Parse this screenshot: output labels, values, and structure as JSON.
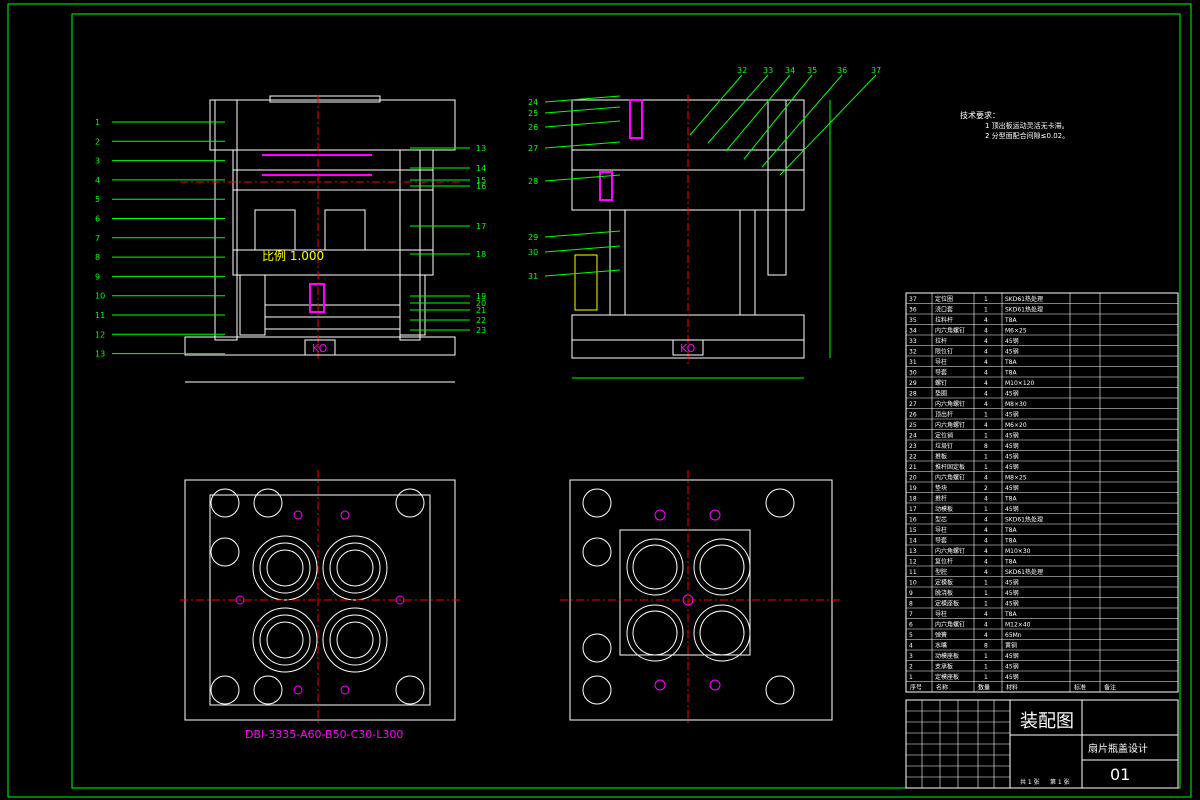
{
  "colors": {
    "background": "#000000",
    "frame": "#00ff00",
    "outline": "#ffffff",
    "centerline": "#ff0000",
    "leader": "#00ff00",
    "accent_cyan": "#00ffff",
    "accent_magenta": "#ff00ff",
    "accent_yellow": "#ffff00"
  },
  "front_view": {
    "scale_label": "比例 1.000",
    "plate_tag": "KO",
    "labels_left": [
      "1",
      "2",
      "3",
      "4",
      "5",
      "6",
      "7",
      "8",
      "9",
      "10",
      "11",
      "12",
      "13"
    ],
    "labels_right": [
      "13",
      "14",
      "15",
      "16",
      "17",
      "18",
      "19",
      "20",
      "21",
      "22",
      "23"
    ]
  },
  "side_view": {
    "plate_tag": "KO",
    "labels_top": [
      "32",
      "33",
      "34",
      "35",
      "36",
      "37"
    ],
    "labels_left": [
      "24",
      "25",
      "26",
      "27",
      "28",
      "29",
      "30",
      "31"
    ]
  },
  "bottom_left_view": {
    "code": "DBI-3335-A60-B50-C30-L300"
  },
  "notes": {
    "title": "技术要求：",
    "items": [
      "1  顶出板运动灵活无卡滞。",
      "2  分型面配合间隙≤0.02。"
    ]
  },
  "bom": {
    "rows": [
      {
        "no": "37",
        "name": "定位圈",
        "qty": "1",
        "material": "SKD61热处理",
        "note": ""
      },
      {
        "no": "36",
        "name": "浇口套",
        "qty": "1",
        "material": "SKD61热处理",
        "note": ""
      },
      {
        "no": "35",
        "name": "拉料杆",
        "qty": "4",
        "material": "T8A",
        "note": ""
      },
      {
        "no": "34",
        "name": "内六角螺钉",
        "qty": "4",
        "material": "M6×25",
        "note": ""
      },
      {
        "no": "33",
        "name": "拉杆",
        "qty": "4",
        "material": "45钢",
        "note": ""
      },
      {
        "no": "32",
        "name": "限位钉",
        "qty": "4",
        "material": "45钢",
        "note": ""
      },
      {
        "no": "31",
        "name": "导柱",
        "qty": "4",
        "material": "T8A",
        "note": ""
      },
      {
        "no": "30",
        "name": "导套",
        "qty": "4",
        "material": "T8A",
        "note": ""
      },
      {
        "no": "29",
        "name": "螺钉",
        "qty": "4",
        "material": "M10×120",
        "note": ""
      },
      {
        "no": "28",
        "name": "垫圈",
        "qty": "4",
        "material": "45钢",
        "note": ""
      },
      {
        "no": "27",
        "name": "内六角螺钉",
        "qty": "4",
        "material": "M8×30",
        "note": ""
      },
      {
        "no": "26",
        "name": "顶出杆",
        "qty": "1",
        "material": "45钢",
        "note": ""
      },
      {
        "no": "25",
        "name": "内六角螺钉",
        "qty": "4",
        "material": "M6×20",
        "note": ""
      },
      {
        "no": "24",
        "name": "定位销",
        "qty": "1",
        "material": "45钢",
        "note": ""
      },
      {
        "no": "23",
        "name": "垃圾钉",
        "qty": "8",
        "material": "45钢",
        "note": ""
      },
      {
        "no": "22",
        "name": "推板",
        "qty": "1",
        "material": "45钢",
        "note": ""
      },
      {
        "no": "21",
        "name": "推杆固定板",
        "qty": "1",
        "material": "45钢",
        "note": ""
      },
      {
        "no": "20",
        "name": "内六角螺钉",
        "qty": "4",
        "material": "M8×25",
        "note": ""
      },
      {
        "no": "19",
        "name": "垫块",
        "qty": "2",
        "material": "45钢",
        "note": ""
      },
      {
        "no": "18",
        "name": "推杆",
        "qty": "4",
        "material": "T8A",
        "note": ""
      },
      {
        "no": "17",
        "name": "动模板",
        "qty": "1",
        "material": "45钢",
        "note": ""
      },
      {
        "no": "16",
        "name": "型芯",
        "qty": "4",
        "material": "SKD61热处理",
        "note": ""
      },
      {
        "no": "15",
        "name": "导柱",
        "qty": "4",
        "material": "T8A",
        "note": ""
      },
      {
        "no": "14",
        "name": "导套",
        "qty": "4",
        "material": "T8A",
        "note": ""
      },
      {
        "no": "13",
        "name": "内六角螺钉",
        "qty": "4",
        "material": "M10×30",
        "note": ""
      },
      {
        "no": "12",
        "name": "复位杆",
        "qty": "4",
        "material": "T8A",
        "note": ""
      },
      {
        "no": "11",
        "name": "型腔",
        "qty": "4",
        "material": "SKD61热处理",
        "note": ""
      },
      {
        "no": "10",
        "name": "定模板",
        "qty": "1",
        "material": "45钢",
        "note": ""
      },
      {
        "no": "9",
        "name": "脱浇板",
        "qty": "1",
        "material": "45钢",
        "note": ""
      },
      {
        "no": "8",
        "name": "定模座板",
        "qty": "1",
        "material": "45钢",
        "note": ""
      },
      {
        "no": "7",
        "name": "导柱",
        "qty": "4",
        "material": "T8A",
        "note": ""
      },
      {
        "no": "6",
        "name": "内六角螺钉",
        "qty": "4",
        "material": "M12×40",
        "note": ""
      },
      {
        "no": "5",
        "name": "弹簧",
        "qty": "4",
        "material": "65Mn",
        "note": ""
      },
      {
        "no": "4",
        "name": "水嘴",
        "qty": "8",
        "material": "黄铜",
        "note": ""
      },
      {
        "no": "3",
        "name": "动模座板",
        "qty": "1",
        "material": "45钢",
        "note": ""
      },
      {
        "no": "2",
        "name": "支承板",
        "qty": "1",
        "material": "45钢",
        "note": ""
      },
      {
        "no": "1",
        "name": "定模座板",
        "qty": "1",
        "material": "45钢",
        "note": ""
      }
    ],
    "headers": {
      "no": "序号",
      "name": "名称",
      "qty": "数量",
      "material": "材料",
      "standard": "标准",
      "note": "备注"
    }
  },
  "title_block": {
    "title": "装配图",
    "part_name": "扇片瓶盖设计",
    "drawing_no": "01",
    "sheet": "共 1 张",
    "sheet2": "第 1 张"
  }
}
